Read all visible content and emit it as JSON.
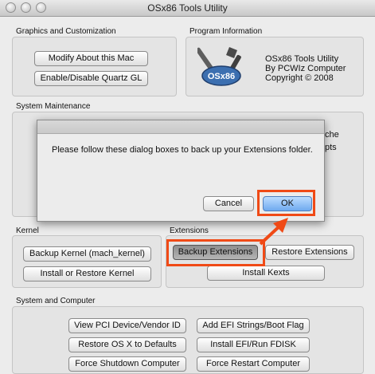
{
  "window": {
    "title": "OSx86 Tools Utility"
  },
  "groups": {
    "graphics": {
      "label": "Graphics and Customization",
      "buttons": [
        "Modify About this Mac",
        "Enable/Disable Quartz GL"
      ]
    },
    "program_info": {
      "label": "Program Information",
      "logo_text": "OSx86",
      "lines": [
        "OSx86 Tools Utility",
        "By PCWIz Computer",
        "Copyright © 2008"
      ]
    },
    "maintenance": {
      "label": "System Maintenance",
      "clipped_right": [
        "che",
        "pts"
      ]
    },
    "kernel": {
      "label": "Kernel",
      "buttons": [
        "Backup Kernel (mach_kernel)",
        "Install or Restore Kernel"
      ]
    },
    "extensions": {
      "label": "Extensions",
      "buttons": [
        "Backup Extensions",
        "Restore Extensions",
        "Install Kexts"
      ]
    },
    "system": {
      "label": "System and Computer",
      "buttons": [
        "View PCI Device/Vendor ID",
        "Add EFI Strings/Boot Flag",
        "Restore OS X to Defaults",
        "Install EFI/Run FDISK",
        "Force Shutdown Computer",
        "Force Restart Computer"
      ]
    }
  },
  "dialog": {
    "message": "Please follow these dialog boxes to back up your Extensions folder.",
    "cancel_label": "Cancel",
    "ok_label": "OK"
  },
  "colors": {
    "highlight": "#f04a16",
    "default_button": "#6fa9ef"
  }
}
